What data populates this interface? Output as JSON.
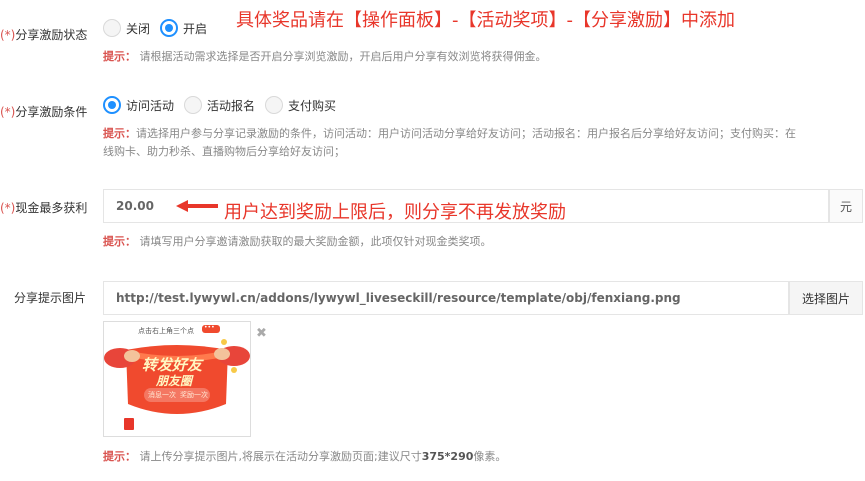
{
  "annotation_top": "具体奖品请在【操作面板】-【活动奖项】-【分享激励】中添加",
  "share_status": {
    "required": "(*)",
    "label": "分享激励状态",
    "options": [
      {
        "label": "关闭",
        "checked": false
      },
      {
        "label": "开启",
        "checked": true
      }
    ],
    "hint_label": "提示：",
    "hint": "请根据活动需求选择是否开启分享浏览激励，开启后用户分享有效浏览将获得佣金。"
  },
  "share_condition": {
    "required": "(*)",
    "label": "分享激励条件",
    "options": [
      {
        "label": "访问活动",
        "checked": true
      },
      {
        "label": "活动报名",
        "checked": false
      },
      {
        "label": "支付购买",
        "checked": false
      }
    ],
    "hint_label": "提示：",
    "hint_line1": "请选择用户参与分享记录激励的条件，访问活动：用户访问活动分享给好友访问；活动报名：用户报名后分享给好友访问；支付购买：在",
    "hint_line2": "线购卡、助力秒杀、直播购物后分享给好友访问；"
  },
  "cash_max": {
    "required": "(*)",
    "label": "现金最多获利",
    "value": "20.00",
    "unit": "元",
    "annotation": "用户达到奖励上限后，则分享不再发放奖励",
    "hint_label": "提示：",
    "hint": "请填写用户分享邀请激励获取的最大奖励金额，此项仅针对现金类奖项。"
  },
  "share_image": {
    "label": "分享提示图片",
    "url": "http://test.lywywl.cn/addons/lywywl_liveseckill/resource/template/obj/fenxiang.png",
    "choose_button": "选择图片",
    "close_glyph": "✖",
    "thumb": {
      "top_text": "点击右上角三个点",
      "badge": "•••",
      "title1": "转发好友",
      "title2": "朋友圈",
      "sub1": "消息一次",
      "sub2": "奖励一次"
    },
    "hint_label": "提示：",
    "hint_pre": "请上传分享提示图片,将展示在活动分享激励页面;建议尺寸",
    "hint_size": "375*290",
    "hint_post": "像素。"
  },
  "colors": {
    "accent": "#1e90ff",
    "annotation": "#e8362a",
    "required": "#d9534f"
  }
}
